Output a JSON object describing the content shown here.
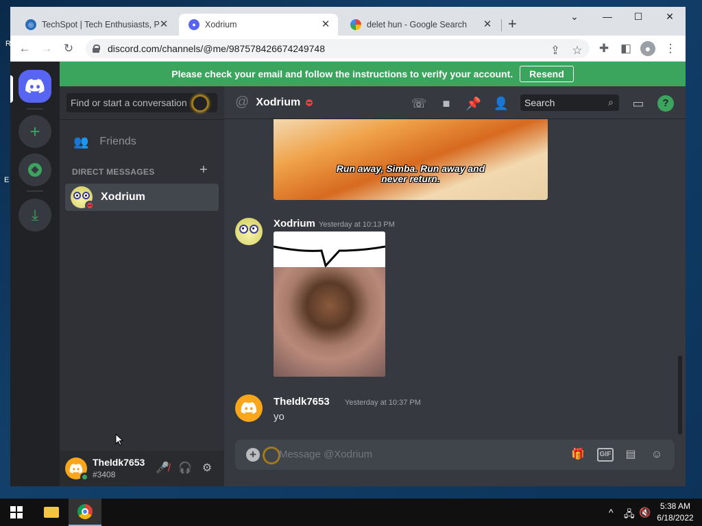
{
  "desktop": {
    "label_r": "R",
    "label_e": "E"
  },
  "browser": {
    "tabs": [
      {
        "title": "TechSpot | Tech Enthusiasts, Pow",
        "close": "✕"
      },
      {
        "title": "Xodrium",
        "close": "✕"
      },
      {
        "title": "delet hun - Google Search",
        "close": "✕"
      }
    ],
    "new_tab": "+",
    "url": "discord.com/channels/@me/987578426674249748"
  },
  "discord": {
    "banner": {
      "text": "Please check your email and follow the instructions to verify your account.",
      "button": "Resend"
    },
    "sidebar": {
      "search_placeholder": "Find or start a conversation",
      "friends_label": "Friends",
      "dm_header": "DIRECT MESSAGES",
      "dm_add": "+",
      "dms": [
        {
          "name": "Xodrium",
          "status": "dnd"
        }
      ]
    },
    "user": {
      "name": "TheIdk7653",
      "tag": "#3408",
      "status": "online"
    },
    "chat": {
      "channel_name": "Xodrium",
      "search_placeholder": "Search",
      "image_caption_line1": "Run away, Simba. Run away and",
      "image_caption_line2": "never return.",
      "messages": [
        {
          "author": "Xodrium",
          "time": "Yesterday at 10:13 PM",
          "content": ""
        },
        {
          "author": "TheIdk7653",
          "time": "Yesterday at 10:37 PM",
          "content": "yo"
        }
      ],
      "composer_placeholder": "Message @Xodrium",
      "gif_label": "GIF"
    },
    "colors": {
      "blurple": "#5865f2",
      "green": "#3ba55d",
      "dnd": "#ed4245",
      "bg": "#36393f"
    }
  },
  "taskbar": {
    "time": "5:38 AM",
    "date": "6/18/2022"
  }
}
